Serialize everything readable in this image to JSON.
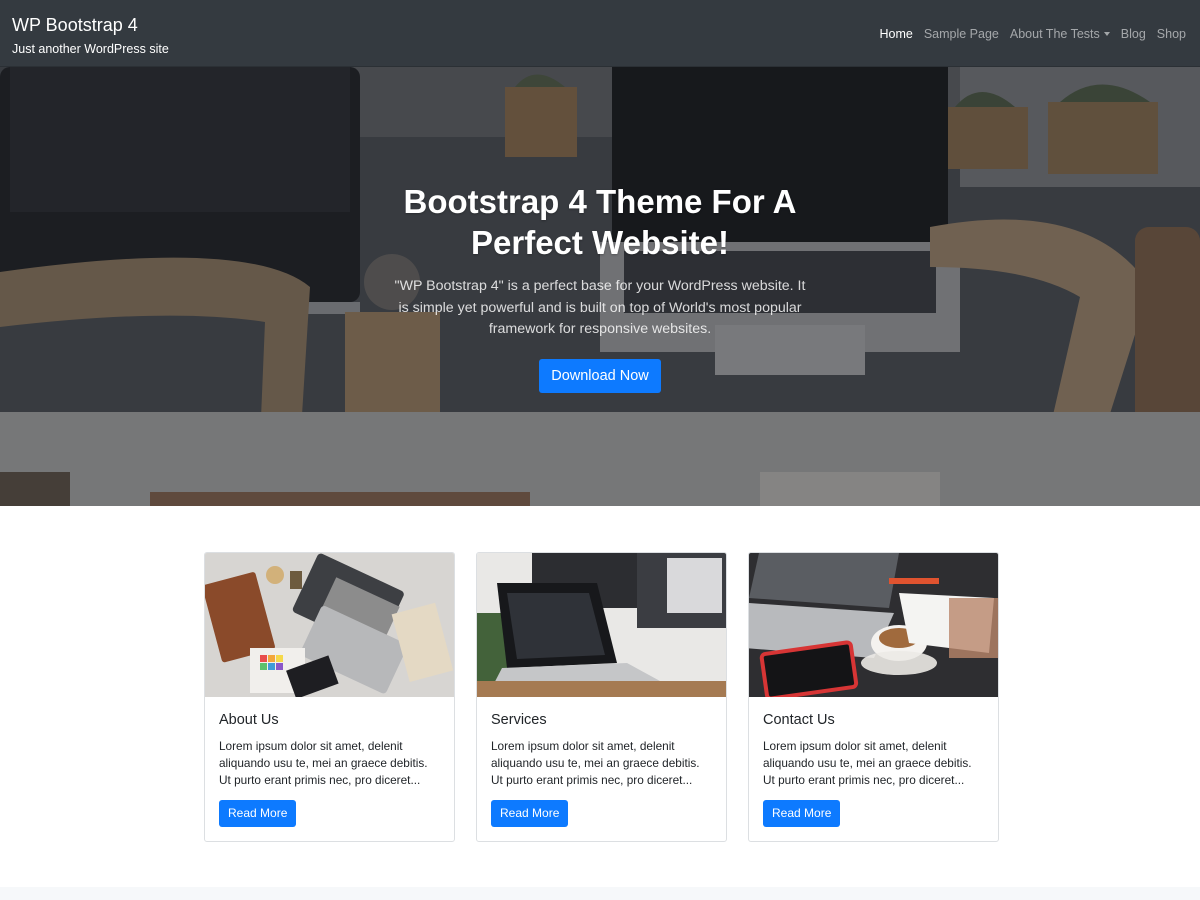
{
  "navbar": {
    "brand_title": "WP Bootstrap 4",
    "brand_tagline": "Just another WordPress site",
    "background_color": "#343a40",
    "items": [
      {
        "label": "Home",
        "active": true
      },
      {
        "label": "Sample Page",
        "active": false
      },
      {
        "label": "About The Tests",
        "active": false,
        "has_dropdown": true,
        "icon": "caret-down-icon"
      },
      {
        "label": "Blog",
        "active": false
      },
      {
        "label": "Shop",
        "active": false
      }
    ]
  },
  "hero": {
    "title": "Bootstrap 4 Theme For A Perfect Website!",
    "lead": "\"WP Bootstrap 4\" is a perfect base for your WordPress website. It is simple yet powerful and is built on top of World's most popular framework for responsive websites.",
    "button_label": "Download Now"
  },
  "cards": [
    {
      "title": "About Us",
      "text": "Lorem ipsum dolor sit amet, delenit aliquando usu te, mei an graece debitis. Ut purto erant primis nec, pro diceret...",
      "button_label": "Read More"
    },
    {
      "title": "Services",
      "text": "Lorem ipsum dolor sit amet, delenit aliquando usu te, mei an graece debitis. Ut purto erant primis nec, pro diceret...",
      "button_label": "Read More"
    },
    {
      "title": "Contact Us",
      "text": "Lorem ipsum dolor sit amet, delenit aliquando usu te, mei an graece debitis. Ut purto erant primis nec, pro diceret...",
      "button_label": "Read More"
    }
  ],
  "colors": {
    "primary": "#007bff",
    "navbar": "#343a40"
  }
}
